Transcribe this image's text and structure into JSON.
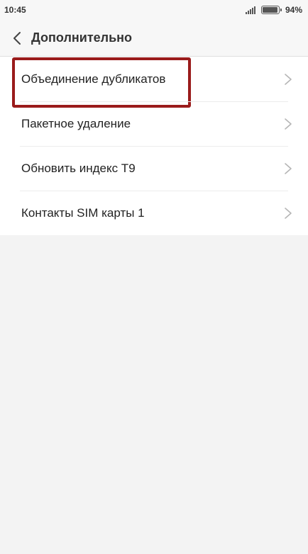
{
  "status_bar": {
    "time": "10:45",
    "battery_percent": "94%",
    "battery_level": 0.94
  },
  "header": {
    "title": "Дополнительно"
  },
  "menu": {
    "items": [
      {
        "label": "Объединение дубликатов",
        "highlighted": true
      },
      {
        "label": "Пакетное удаление",
        "highlighted": false
      },
      {
        "label": "Обновить индекс Т9",
        "highlighted": false
      },
      {
        "label": "Контакты SIM карты 1",
        "highlighted": false
      }
    ]
  },
  "colors": {
    "highlight_border": "#9a1b1b",
    "background": "#f3f3f3",
    "list_background": "#ffffff"
  }
}
